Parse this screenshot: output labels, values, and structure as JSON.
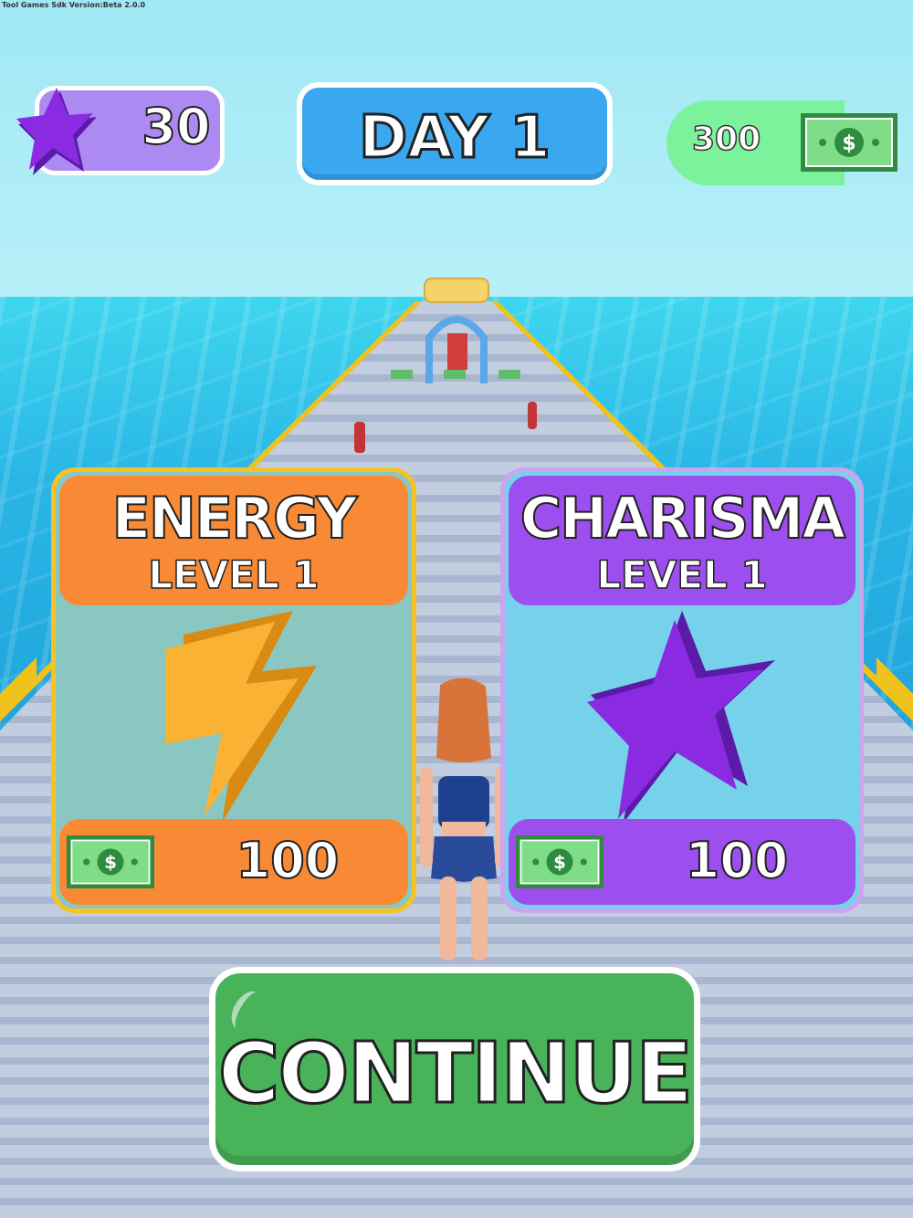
{
  "sdk_label": "Tool Games Sdk Version:Beta 2.0.0",
  "hud": {
    "stars": "30",
    "day": "DAY 1",
    "cash": "300"
  },
  "cards": {
    "energy": {
      "title": "ENERGY",
      "level": "LEVEL 1",
      "price": "100",
      "icon": "lightning-bolt-icon",
      "color": "#f88a36"
    },
    "charisma": {
      "title": "CHARISMA",
      "level": "LEVEL 1",
      "price": "100",
      "icon": "star-icon",
      "color": "#9d4eef"
    }
  },
  "continue_label": "CONTINUE",
  "colors": {
    "accent_green": "#49b35a",
    "day_blue": "#3aa8f0",
    "star_purple": "#8a2be2",
    "bolt_yellow": "#f9b233"
  }
}
